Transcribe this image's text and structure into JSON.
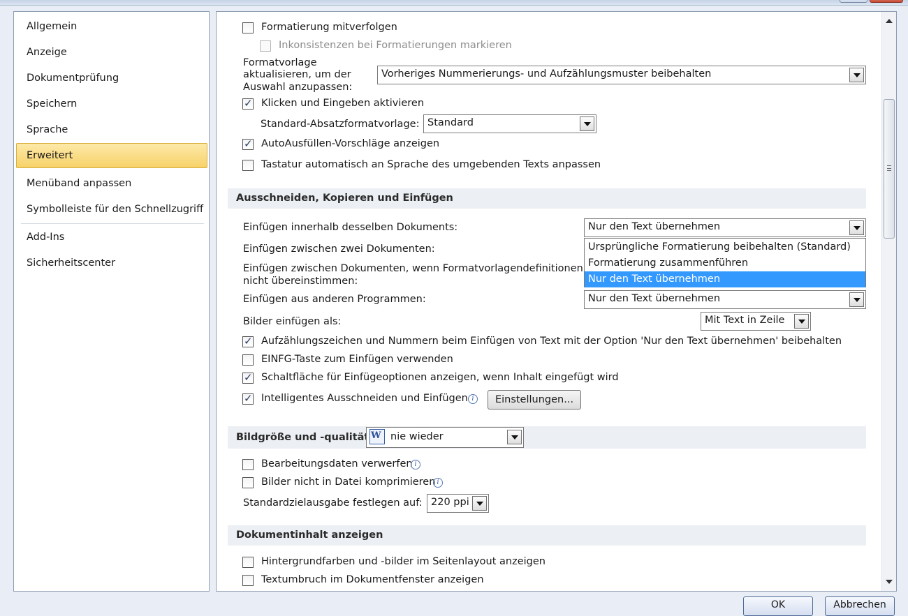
{
  "sidebar": {
    "items": [
      {
        "label": "Allgemein"
      },
      {
        "label": "Anzeige"
      },
      {
        "label": "Dokumentprüfung"
      },
      {
        "label": "Speichern"
      },
      {
        "label": "Sprache"
      },
      {
        "label": "Erweitert"
      },
      {
        "label": "Menüband anpassen"
      },
      {
        "label": "Symbolleiste für den Schnellzugriff"
      },
      {
        "label": "Add-Ins"
      },
      {
        "label": "Sicherheitscenter"
      }
    ],
    "active": "Erweitert"
  },
  "editing": {
    "track_formatting": {
      "label": "Formatierung mitverfolgen",
      "checked": false
    },
    "mark_inconsistencies": {
      "label": "Inkonsistenzen bei Formatierungen markieren",
      "checked": false,
      "disabled": true
    },
    "style_update": {
      "label_line1": "Formatvorlage",
      "label_line2": "aktualisieren, um der",
      "label_line3": "Auswahl anzupassen:",
      "value": "Vorheriges Nummerierungs- und Aufzählungsmuster beibehalten"
    },
    "click_and_type": {
      "label": "Klicken und Eingeben aktivieren",
      "checked": true
    },
    "default_para_style": {
      "label": "Standard-Absatzformatvorlage:",
      "value": "Standard"
    },
    "autocomplete": {
      "label": "AutoAusfüllen-Vorschläge anzeigen",
      "checked": true
    },
    "keyboard_lang": {
      "label": "Tastatur automatisch an Sprache des umgebenden Texts anpassen",
      "checked": false
    }
  },
  "cut_copy_paste": {
    "title": "Ausschneiden, Kopieren und Einfügen",
    "within_doc": {
      "label": "Einfügen innerhalb desselben Dokuments:",
      "value": "Nur den Text übernehmen"
    },
    "between_docs": {
      "label": "Einfügen zwischen zwei Dokumenten:"
    },
    "between_docs_conflict": {
      "label_line1": "Einfügen zwischen Dokumenten, wenn Formatvorlagendefinitionen",
      "label_line2": "nicht übereinstimmen:"
    },
    "dropdown_options": [
      "Ursprüngliche Formatierung beibehalten (Standard)",
      "Formatierung zusammenführen",
      "Nur den Text übernehmen"
    ],
    "dropdown_selected_index": 2,
    "from_other_programs": {
      "label": "Einfügen aus anderen Programmen:",
      "value": "Nur den Text übernehmen"
    },
    "insert_pictures": {
      "label": "Bilder einfügen als:",
      "value": "Mit Text in Zeile"
    },
    "keep_bullets": {
      "label": "Aufzählungszeichen und Nummern beim Einfügen von Text mit der Option 'Nur den Text übernehmen' beibehalten",
      "checked": true
    },
    "insert_key": {
      "label": "EINFG-Taste zum Einfügen verwenden",
      "checked": false
    },
    "paste_options_button": {
      "label": "Schaltfläche für Einfügeoptionen anzeigen, wenn Inhalt eingefügt wird",
      "checked": true
    },
    "smart_cut": {
      "label": "Intelligentes Ausschneiden und Einfügen",
      "checked": true
    },
    "settings_button": "Einstellungen..."
  },
  "image_quality": {
    "title": "Bildgröße und -qualität",
    "document_value": "nie wieder",
    "discard_editing": {
      "label": "Bearbeitungsdaten verwerfen",
      "checked": false
    },
    "no_compress": {
      "label": "Bilder nicht in Datei komprimieren",
      "checked": false
    },
    "default_target": {
      "label": "Standardzielausgabe festlegen auf:",
      "value": "220 ppi"
    }
  },
  "document_content": {
    "title": "Dokumentinhalt anzeigen",
    "bg_colors": {
      "label": "Hintergrundfarben und -bilder im Seitenlayout anzeigen",
      "checked": false
    },
    "text_wrap": {
      "label": "Textumbruch im Dokumentfenster anzeigen",
      "checked": false
    }
  },
  "footer": {
    "ok": "OK",
    "cancel": "Abbrechen"
  },
  "colors": {
    "accent": "#3399ff",
    "active_nav": "#f7d26a",
    "section_bg": "#eceff3"
  }
}
